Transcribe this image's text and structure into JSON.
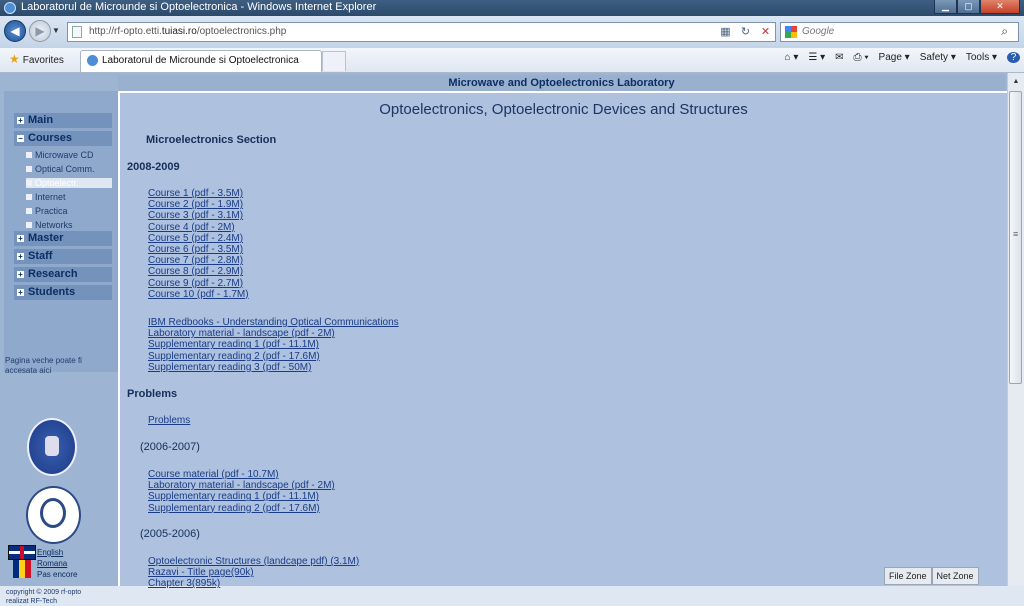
{
  "window": {
    "title": "Laboratorul de Microunde si Optoelectronica - Windows Internet Explorer"
  },
  "address_bar": {
    "url_prefix": "http://rf-opto.etti.",
    "url_domain": "tuiasi.ro",
    "url_path": "/optoelectronics.php",
    "search_placeholder": "Google"
  },
  "command_bar": {
    "favorites_label": "Favorites",
    "tab_label": "Laboratorul de Microunde si Optoelectronica",
    "page_label": "Page ▾",
    "safety_label": "Safety ▾",
    "tools_label": "Tools ▾",
    "help_label": "?"
  },
  "banner": "Microwave and Optoelectronics Laboratory",
  "sidebar": {
    "menu": [
      {
        "label": "Main"
      },
      {
        "label": "Courses"
      },
      {
        "label": "Master"
      },
      {
        "label": "Staff"
      },
      {
        "label": "Research"
      },
      {
        "label": "Students"
      }
    ],
    "courses_sub": [
      {
        "label": "Microwave CD"
      },
      {
        "label": "Optical Comm."
      },
      {
        "label": "Optoelectr."
      },
      {
        "label": "Internet"
      },
      {
        "label": "Practica"
      },
      {
        "label": "Networks"
      }
    ],
    "old_page_text": "Pagina veche poate fi accesata",
    "old_page_link": "aici",
    "languages": [
      {
        "label": "English"
      },
      {
        "label": "Romana"
      },
      {
        "label": "Pas encore"
      }
    ],
    "copyright_line1": "copyright © 2009 rf-opto",
    "copyright_line2": "realizat RF-Tech"
  },
  "content": {
    "title": "Optoelectronics, Optoelectronic Devices and Structures",
    "section": "Microelectronics Section",
    "year1": "2008-2009",
    "courses": [
      "Course 1 (pdf - 3.5M)",
      "Course 2 (pdf - 1.9M)",
      "Course 3 (pdf - 3.1M)",
      "Course 4 (pdf - 2M)",
      "Course 5 (pdf - 2.4M)",
      "Course 6 (pdf - 3.5M)",
      "Course 7 (pdf - 2.8M)",
      "Course 8 (pdf - 2.9M)",
      "Course 9 (pdf - 2.7M)",
      "Course 10 (pdf - 1.7M)"
    ],
    "extras": [
      "IBM Redbooks - Understanding Optical Communications",
      "Laboratory material - landscape (pdf - 2M)",
      "Supplementary reading 1 (pdf - 11.1M)",
      "Supplementary reading 2 (pdf - 17.6M)",
      "Supplementary reading 3 (pdf - 50M)"
    ],
    "problems_heading": "Problems",
    "problems_link": "Problems",
    "year2": "(2006-2007)",
    "year2_links": [
      "Course material (pdf - 10.7M)",
      "Laboratory material - landscape (pdf - 2M)",
      "Supplementary reading 1 (pdf - 11.1M)",
      "Supplementary reading 2 (pdf - 17.6M)"
    ],
    "year3": "(2005-2006)",
    "year3_links": [
      "Optoelectronic Structures (landcape pdf) (3.1M)",
      "Razavi - Title page(90k)",
      "Chapter 3(895k)"
    ]
  },
  "zones": [
    "File Zone",
    "Net Zone"
  ]
}
